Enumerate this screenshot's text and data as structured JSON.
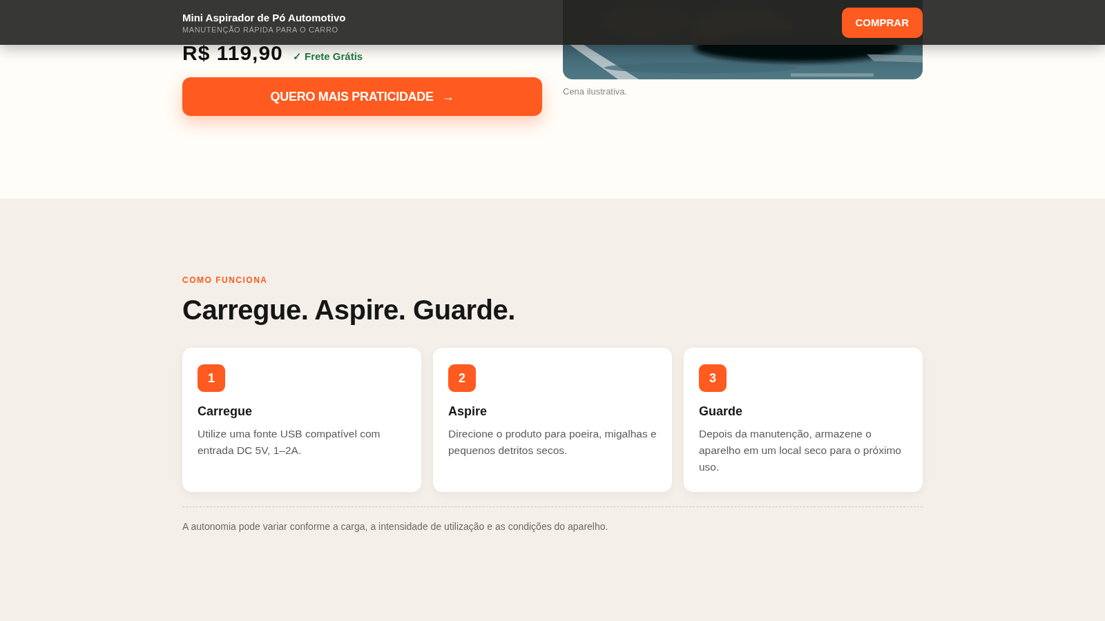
{
  "header": {
    "title": "Mini Aspirador de Pó Automotivo",
    "subtitle": "MANUTENÇÃO RÁPIDA PARA O CARRO",
    "buy_button": "COMPRAR"
  },
  "hero": {
    "price": "R$ 119,90",
    "shipping": "✓ Frete Grátis",
    "cta": {
      "label": "QUERO MAIS PRATICIDADE",
      "arrow": "→"
    },
    "caption": "Cena ilustrativa."
  },
  "how_it_works": {
    "eyebrow": "COMO FUNCIONA",
    "heading": "Carregue. Aspire. Guarde.",
    "steps": [
      {
        "number": "1",
        "title": "Carregue",
        "text": "Utilize uma fonte USB compatível com entrada DC 5V, 1–2A."
      },
      {
        "number": "2",
        "title": "Aspire",
        "text": "Direcione o produto para poeira, migalhas e pequenos detritos secos."
      },
      {
        "number": "3",
        "title": "Guarde",
        "text": "Depois da manutenção, armazene o aparelho em um local seco para o próximo uso."
      }
    ],
    "note": "A autonomia pode variar conforme a carga, a intensidade de utilização e as condições do aparelho."
  }
}
